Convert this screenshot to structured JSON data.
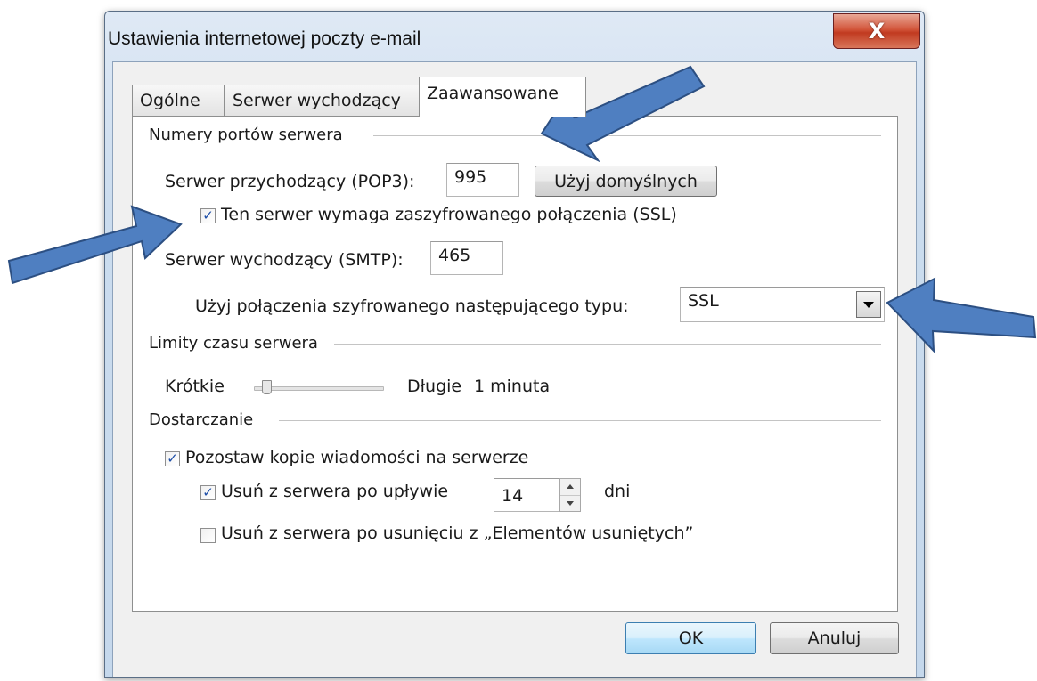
{
  "window": {
    "title": "Ustawienia internetowej poczty e-mail",
    "close_label": "X"
  },
  "tabs": [
    {
      "label": "Ogólne"
    },
    {
      "label": "Serwer wychodzący"
    },
    {
      "label": "Zaawansowane",
      "active": true
    }
  ],
  "ports": {
    "group_label": "Numery portów serwera",
    "incoming_label": "Serwer przychodzący (POP3):",
    "incoming_value": "995",
    "defaults_button": "Użyj domyślnych",
    "ssl_checkbox_label": "Ten serwer wymaga zaszyfrowanego połączenia (SSL)",
    "ssl_checked": true,
    "outgoing_label": "Serwer wychodzący (SMTP):",
    "outgoing_value": "465",
    "encryption_label": "Użyj połączenia szyfrowanego następującego typu:",
    "encryption_value": "SSL"
  },
  "timeouts": {
    "group_label": "Limity czasu serwera",
    "short_label": "Krótkie",
    "long_label": "Długie",
    "value_label": "1 minuta",
    "slider_fraction": 0.1
  },
  "delivery": {
    "group_label": "Dostarczanie",
    "leave_copy_label": "Pozostaw kopie wiadomości na serwerze",
    "leave_copy_checked": true,
    "remove_after_label": "Usuń z serwera po upływie",
    "remove_after_checked": true,
    "remove_after_days": "14",
    "days_unit": "dni",
    "remove_deleted_label": "Usuń z serwera po usunięciu z „Elementów usuniętych”",
    "remove_deleted_checked": false
  },
  "buttons": {
    "ok": "OK",
    "cancel": "Anuluj"
  },
  "colors": {
    "annotation_arrow": "#4f7fc1",
    "annotation_arrow_border": "#2c4f82"
  }
}
